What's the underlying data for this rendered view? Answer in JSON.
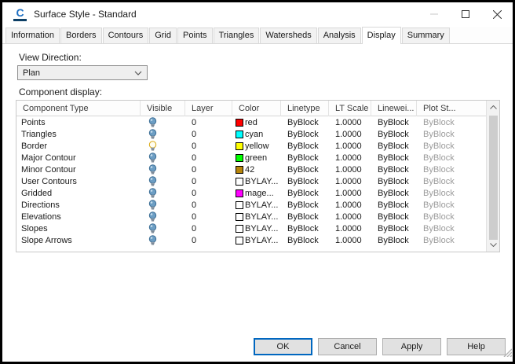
{
  "window": {
    "title": "Surface Style - Standard",
    "icon_glyph": "C"
  },
  "tabs": {
    "items": [
      "Information",
      "Borders",
      "Contours",
      "Grid",
      "Points",
      "Triangles",
      "Watersheds",
      "Analysis",
      "Display",
      "Summary"
    ],
    "active": "Display"
  },
  "view_direction": {
    "label": "View Direction:",
    "value": "Plan"
  },
  "component_display": {
    "label": "Component display:"
  },
  "table": {
    "columns": [
      "Component Type",
      "Visible",
      "Layer",
      "Color",
      "Linetype",
      "LT Scale",
      "Linewei...",
      "Plot St..."
    ],
    "rows": [
      {
        "name": "Points",
        "visible": "bulb-on-blue",
        "layer": "0",
        "color_hex": "#FF0000",
        "color_label": "red",
        "linetype": "ByBlock",
        "lt_scale": "1.0000",
        "lineweight": "ByBlock",
        "plot_style": "ByBlock"
      },
      {
        "name": "Triangles",
        "visible": "bulb-on-blue",
        "layer": "0",
        "color_hex": "#00FFFF",
        "color_label": "cyan",
        "linetype": "ByBlock",
        "lt_scale": "1.0000",
        "lineweight": "ByBlock",
        "plot_style": "ByBlock"
      },
      {
        "name": "Border",
        "visible": "bulb-on-yellow",
        "layer": "0",
        "color_hex": "#FFFF00",
        "color_label": "yellow",
        "linetype": "ByBlock",
        "lt_scale": "1.0000",
        "lineweight": "ByBlock",
        "plot_style": "ByBlock"
      },
      {
        "name": "Major Contour",
        "visible": "bulb-on-blue",
        "layer": "0",
        "color_hex": "#00FF00",
        "color_label": "green",
        "linetype": "ByBlock",
        "lt_scale": "1.0000",
        "lineweight": "ByBlock",
        "plot_style": "ByBlock"
      },
      {
        "name": "Minor Contour",
        "visible": "bulb-on-blue",
        "layer": "0",
        "color_hex": "#B8860B",
        "color_label": "42",
        "linetype": "ByBlock",
        "lt_scale": "1.0000",
        "lineweight": "ByBlock",
        "plot_style": "ByBlock"
      },
      {
        "name": "User Contours",
        "visible": "bulb-on-blue",
        "layer": "0",
        "color_hex": "#FFFFFF",
        "color_label": "BYLAY...",
        "linetype": "ByBlock",
        "lt_scale": "1.0000",
        "lineweight": "ByBlock",
        "plot_style": "ByBlock"
      },
      {
        "name": "Gridded",
        "visible": "bulb-on-blue",
        "layer": "0",
        "color_hex": "#FF00FF",
        "color_label": "mage...",
        "linetype": "ByBlock",
        "lt_scale": "1.0000",
        "lineweight": "ByBlock",
        "plot_style": "ByBlock"
      },
      {
        "name": "Directions",
        "visible": "bulb-on-blue",
        "layer": "0",
        "color_hex": "#FFFFFF",
        "color_label": "BYLAY...",
        "linetype": "ByBlock",
        "lt_scale": "1.0000",
        "lineweight": "ByBlock",
        "plot_style": "ByBlock"
      },
      {
        "name": "Elevations",
        "visible": "bulb-on-blue",
        "layer": "0",
        "color_hex": "#FFFFFF",
        "color_label": "BYLAY...",
        "linetype": "ByBlock",
        "lt_scale": "1.0000",
        "lineweight": "ByBlock",
        "plot_style": "ByBlock"
      },
      {
        "name": "Slopes",
        "visible": "bulb-on-blue",
        "layer": "0",
        "color_hex": "#FFFFFF",
        "color_label": "BYLAY...",
        "linetype": "ByBlock",
        "lt_scale": "1.0000",
        "lineweight": "ByBlock",
        "plot_style": "ByBlock"
      },
      {
        "name": "Slope Arrows",
        "visible": "bulb-on-blue",
        "layer": "0",
        "color_hex": "#FFFFFF",
        "color_label": "BYLAY...",
        "linetype": "ByBlock",
        "lt_scale": "1.0000",
        "lineweight": "ByBlock",
        "plot_style": "ByBlock"
      }
    ]
  },
  "footer": {
    "buttons": [
      "OK",
      "Cancel",
      "Apply",
      "Help"
    ],
    "focused": "OK"
  },
  "colors": {
    "bulb_blue": "#6d9ec4",
    "bulb_blue_dark": "#3c6e96",
    "bulb_lit_fill": "#fffdf0",
    "bulb_lit_stroke": "#dba90f",
    "focus_border": "#0067c0",
    "plot_style_text": "#9b9b9b"
  }
}
